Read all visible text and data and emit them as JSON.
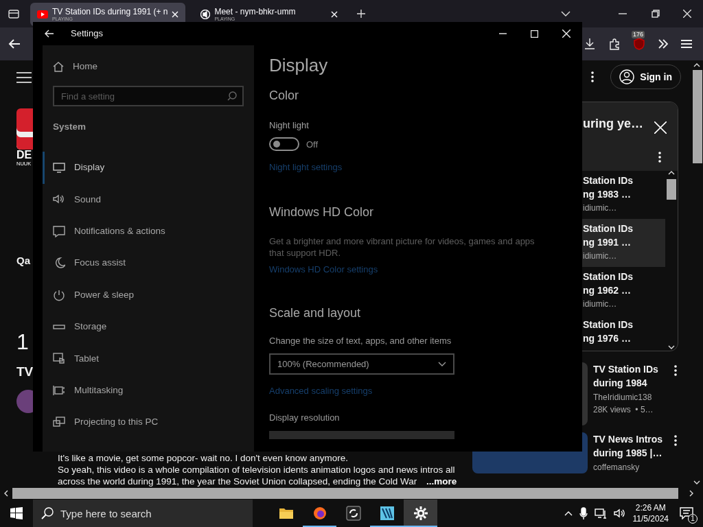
{
  "browser": {
    "tabs": [
      {
        "title": "TV Station IDs during 1991 (+ n",
        "subtitle": "PLAYING",
        "kind": "video",
        "selected": true
      },
      {
        "title": "Meet - nym-bhkr-umm",
        "subtitle": "PLAYING",
        "kind": "meet",
        "selected": false
      }
    ],
    "extension_badge": "176"
  },
  "page": {
    "left_fragments": [
      {
        "kind": "logo",
        "text": "DE",
        "subtext": "NUUK"
      },
      {
        "kind": "label",
        "text": "Qa"
      },
      {
        "kind": "number",
        "text": "1"
      },
      {
        "kind": "heading",
        "text": "TV"
      }
    ],
    "sign_in": "Sign in",
    "playlist": {
      "title": "uring ye…",
      "items": [
        {
          "line_1": "Station IDs",
          "line_2": "ng 1983 …",
          "channel": "idiumic…",
          "selected": false
        },
        {
          "line_1": "Station IDs",
          "line_2": "ng 1991 …",
          "channel": "idiumic…",
          "selected": true
        },
        {
          "line_1": "Station IDs",
          "line_2": "ng 1962 …",
          "channel": "idiumic…",
          "selected": false
        },
        {
          "line_1": "Station IDs",
          "line_2": "ng 1976 …",
          "selected": false
        }
      ]
    },
    "recommendations": [
      {
        "title": "TV Station IDs during 1984",
        "channel": "TheIridiumic138",
        "meta": "28K views  • 5…"
      },
      {
        "title": "TV News Intros during 1985 |…",
        "channel": "coffemansky"
      }
    ],
    "description": [
      "It's like a movie, get some popcor- wait no. I don't even know anymore.",
      "So yeah, this video is a whole compilation of television idents animation logos and news intros all",
      "across the world during 1991, the year the Soviet Union collapsed, ending the Cold War"
    ],
    "more": "...more"
  },
  "settings": {
    "title": "Settings",
    "home": "Home",
    "search": {
      "placeholder": "Find a setting"
    },
    "section": "System",
    "nav": [
      {
        "label": "Display",
        "kind": "display",
        "selected": true
      },
      {
        "label": "Sound",
        "kind": "sound",
        "selected": false
      },
      {
        "label": "Notifications & actions",
        "kind": "notifications",
        "selected": false
      },
      {
        "label": "Focus assist",
        "kind": "focus",
        "selected": false
      },
      {
        "label": "Power & sleep",
        "kind": "power",
        "selected": false
      },
      {
        "label": "Storage",
        "kind": "storage",
        "selected": false
      },
      {
        "label": "Tablet",
        "kind": "tablet",
        "selected": false
      },
      {
        "label": "Multitasking",
        "kind": "multitasking",
        "selected": false
      },
      {
        "label": "Projecting to this PC",
        "kind": "projecting",
        "selected": false
      }
    ],
    "heading": "Display",
    "color": {
      "title": "Color",
      "night_light_label": "Night light",
      "night_light": {
        "on": false,
        "state_text": "Off"
      },
      "link": "Night light settings"
    },
    "hd_color": {
      "title": "Windows HD Color",
      "description": "Get a brighter and more vibrant picture for videos, games and apps that support HDR.",
      "link": "Windows HD Color settings"
    },
    "scale": {
      "title": "Scale and layout",
      "label": "Change the size of text, apps, and other items",
      "dropdown": "100% (Recommended)",
      "link": "Advanced scaling settings",
      "resolution_label": "Display resolution"
    }
  },
  "taskbar": {
    "search": {
      "placeholder": "Type here to search"
    },
    "apps": [
      {
        "kind": "folder",
        "running": false,
        "selected": false
      },
      {
        "kind": "browser",
        "running": true,
        "selected": false
      },
      {
        "kind": "sync",
        "running": false,
        "selected": false
      },
      {
        "kind": "editor",
        "running": true,
        "selected": false
      },
      {
        "kind": "gear",
        "running": true,
        "selected": true
      }
    ],
    "time": "2:26 AM",
    "date": "11/5/2024",
    "notification_count": "1"
  }
}
